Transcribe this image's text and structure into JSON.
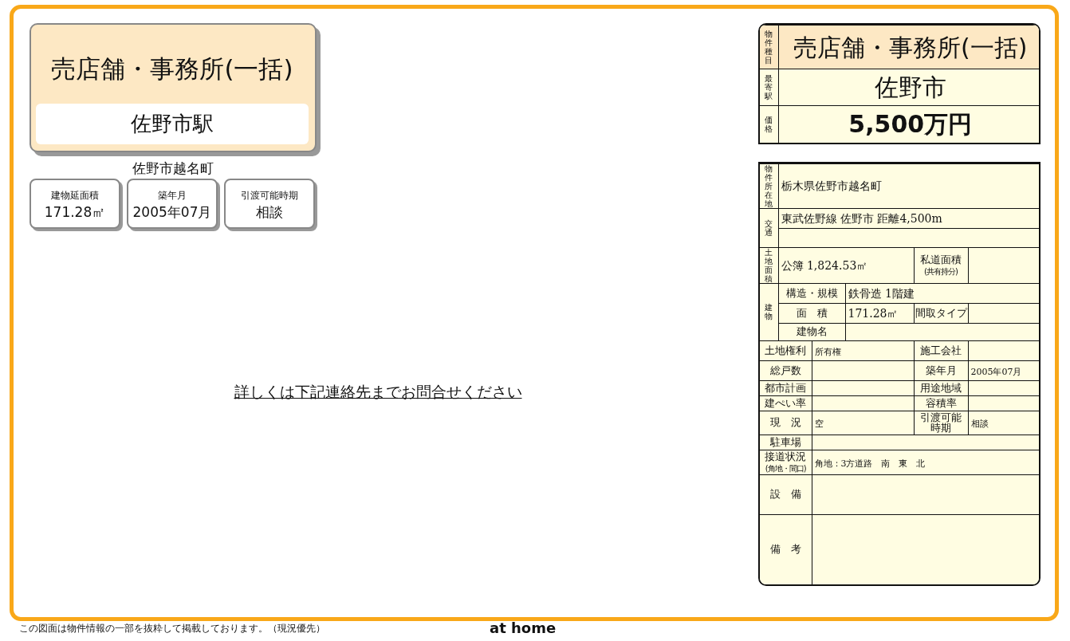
{
  "headline": {
    "type": "売店舗・事務所(一括)",
    "station": "佐野市駅"
  },
  "address": "佐野市越名町",
  "facts": [
    {
      "label": "建物延面積",
      "value": "171.28㎡"
    },
    {
      "label": "築年月",
      "value": "2005年07月"
    },
    {
      "label": "引渡可能時期",
      "value": "相談"
    }
  ],
  "contact_note": "詳しくは下記連絡先までお問合せください",
  "summary": [
    {
      "kind": "type",
      "label": "物件種目",
      "value": "売店舗・事務所(一括)"
    },
    {
      "kind": "station",
      "label": "最寄駅",
      "value": "佐野市"
    },
    {
      "kind": "price",
      "label": "価格",
      "value": "5,500万円"
    }
  ],
  "details": [
    {
      "kind": "wide",
      "label": "物件所在地",
      "value": "栃木県佐野市越名町"
    },
    {
      "kind": "traffic",
      "label": "交通",
      "value": "東武佐野線 佐野市 距離4,500m"
    },
    {
      "kind": "side",
      "label": "土地面積",
      "value": "公簿 1,824.53㎡",
      "side_label": "私道面積",
      "side_sub": "(共有持分)"
    },
    {
      "kind": "building",
      "label": "建物",
      "items": [
        {
          "label": "構造・規模",
          "value": "鉄骨造 1階建"
        },
        {
          "label": "面　積",
          "value": "171.28㎡",
          "side_label": "間取タイプ"
        },
        {
          "label": "建物名"
        }
      ]
    },
    {
      "kind": "pair",
      "label": "土地権利",
      "value": "所有権",
      "side_label": "施工会社"
    },
    {
      "kind": "pair",
      "label": "総戸数",
      "side_label": "築年月",
      "side_value": "2005年07月"
    },
    {
      "kind": "pair",
      "label": "都市計画",
      "side_label": "用途地域"
    },
    {
      "kind": "pair",
      "label": "建ぺい率",
      "side_label": "容積率"
    },
    {
      "kind": "pair",
      "label": "現　況",
      "value": "空",
      "side_label": "引渡可能時期",
      "side_value": "相談"
    },
    {
      "kind": "single",
      "label": "駐車場"
    },
    {
      "kind": "single",
      "label": "接道状況",
      "sub_label": "(角地・間口)",
      "value": "角地：3方道路　南　東　北"
    },
    {
      "kind": "block",
      "label": "設　備"
    },
    {
      "kind": "remarks",
      "label": "備　考"
    }
  ],
  "footer": {
    "note": "この図面は物件情報の一部を抜粋して掲載しております。（現況優先）",
    "logo": "at home"
  }
}
